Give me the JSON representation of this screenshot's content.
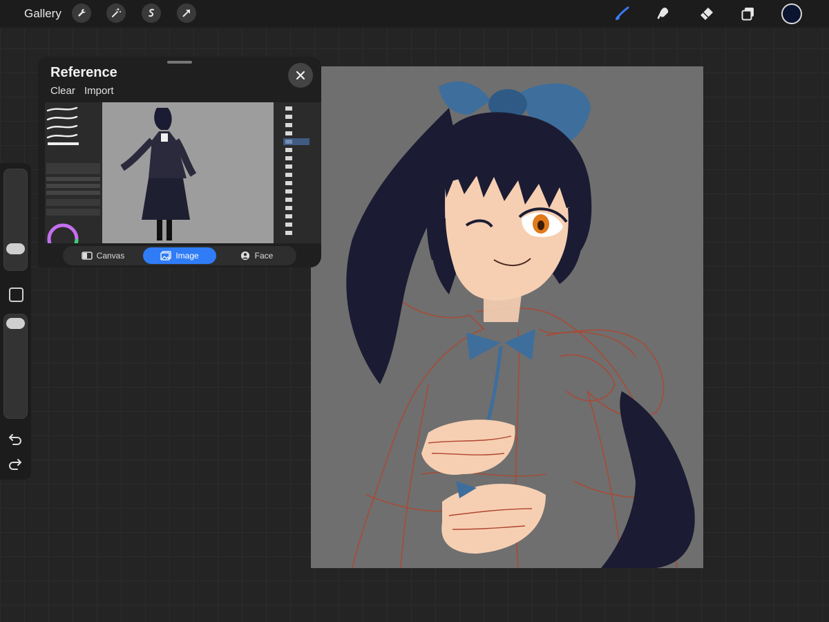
{
  "toolbar": {
    "gallery_label": "Gallery",
    "left_tools": [
      "wrench-icon",
      "magic-wand-icon",
      "selection-icon",
      "transform-arrow-icon"
    ],
    "right_tools": [
      "brush-icon",
      "smudge-icon",
      "eraser-icon",
      "layers-icon"
    ],
    "current_color": "#0b1530",
    "active_tool_color": "#3b7cf6"
  },
  "sidebar": {
    "brush_size_level": 0.8,
    "opacity_level": 0.0,
    "modify_button": "square-modify-button",
    "undo_icon": "undo-icon",
    "redo_icon": "redo-icon"
  },
  "reference": {
    "title": "Reference",
    "clear_label": "Clear",
    "import_label": "Import",
    "tabs": [
      {
        "label": "Canvas",
        "icon": "canvas-icon",
        "active": false
      },
      {
        "label": "Image",
        "icon": "image-icon",
        "active": true
      },
      {
        "label": "Face",
        "icon": "face-icon",
        "active": false
      }
    ]
  },
  "canvas": {
    "background": "#6f6f6f",
    "sketch_color": "#b0452e",
    "hair_color": "#1b1c33",
    "ribbon_color": "#3e6e9c",
    "skin_color": "#f6cfb2",
    "eye_color": "#e07a1c"
  },
  "colors": {
    "accent": "#2f7cf6",
    "panel_bg": "#1f1f1f",
    "app_bg": "#242424"
  }
}
